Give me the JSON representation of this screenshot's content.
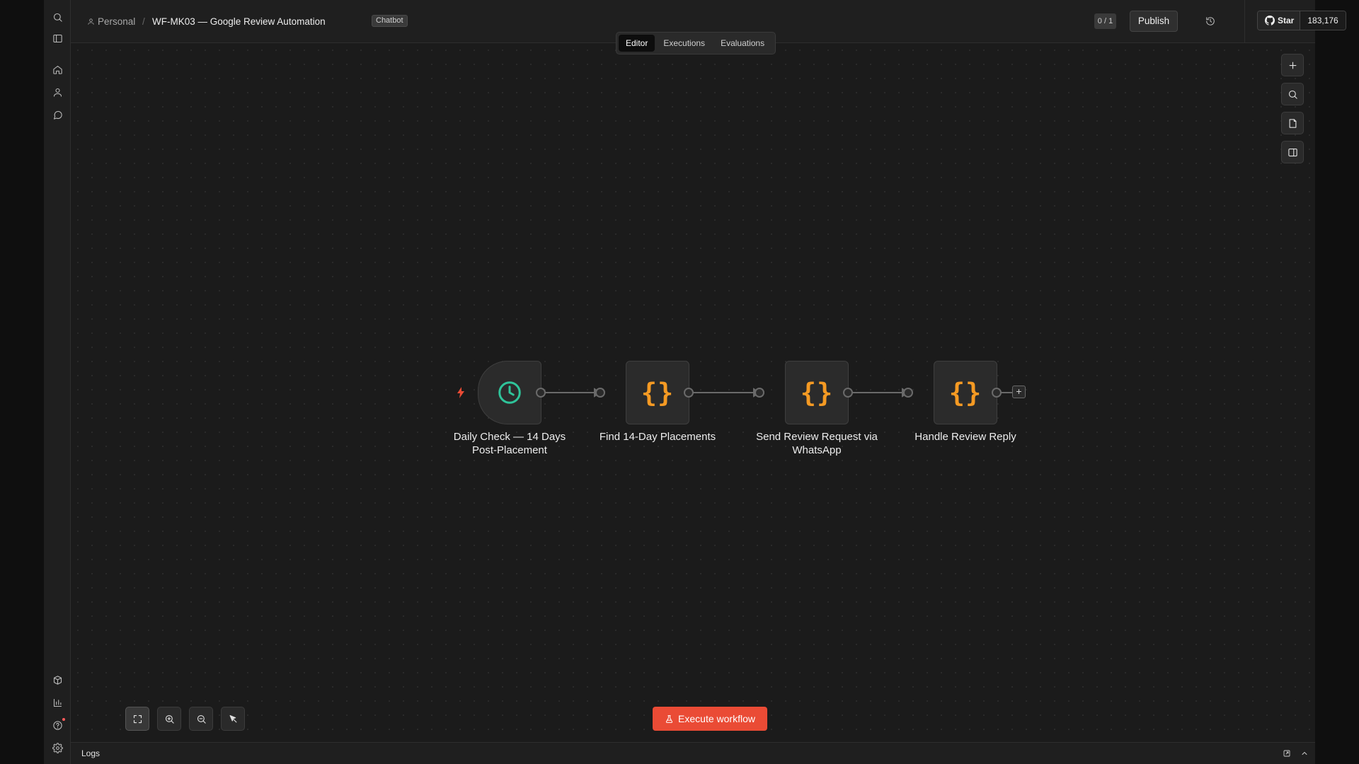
{
  "breadcrumb": {
    "user_icon": "user-icon",
    "owner": "Personal",
    "separator": "/",
    "workflow_name": "WF-MK03 — Google Review Automation",
    "tag": "Chatbot"
  },
  "tabs": [
    {
      "label": "Editor",
      "active": true
    },
    {
      "label": "Executions",
      "active": false
    },
    {
      "label": "Evaluations",
      "active": false
    }
  ],
  "header": {
    "counter": "0 / 1",
    "publish_label": "Publish",
    "history_icon": "history-icon",
    "github_star_label": "Star",
    "github_star_count": "183,176"
  },
  "sidebar": {
    "top_icons": [
      "search-icon",
      "sidebar-toggle-icon",
      "home-icon",
      "user-icon",
      "chat-icon"
    ],
    "bottom_icons": [
      "templates-icon",
      "insights-icon",
      "help-icon",
      "settings-icon"
    ]
  },
  "canvas_tools": [
    "add-node-icon",
    "search-icon",
    "sticky-note-icon",
    "panel-toggle-icon"
  ],
  "workflow": {
    "nodes": [
      {
        "id": "n1",
        "kind": "schedule-trigger",
        "icon": "clock-icon",
        "label_line1": "Daily Check — 14 Days",
        "label_line2": "Post-Placement"
      },
      {
        "id": "n2",
        "kind": "code",
        "icon": "braces-icon",
        "symbol": "{}",
        "label_line1": "Find 14-Day Placements",
        "label_line2": ""
      },
      {
        "id": "n3",
        "kind": "code",
        "icon": "braces-icon",
        "symbol": "{}",
        "label_line1": "Send Review Request via",
        "label_line2": "WhatsApp"
      },
      {
        "id": "n4",
        "kind": "code",
        "icon": "braces-icon",
        "symbol": "{}",
        "label_line1": "Handle Review Reply",
        "label_line2": ""
      }
    ],
    "connections": [
      [
        "n1",
        "n2"
      ],
      [
        "n2",
        "n3"
      ],
      [
        "n3",
        "n4"
      ]
    ],
    "trigger_marker_icon": "lightning-icon",
    "add_node_symbol": "+"
  },
  "zoom_controls": [
    "fit-view-icon",
    "zoom-in-icon",
    "zoom-out-icon",
    "tidy-up-icon"
  ],
  "execute_button": {
    "label": "Execute workflow",
    "icon": "flask-icon"
  },
  "logs": {
    "label": "Logs",
    "icons": [
      "popout-icon",
      "chevron-up-icon"
    ]
  },
  "colors": {
    "accent": "#ea4b35",
    "trigger_icon": "#2fc49a",
    "code_icon": "#f59a23",
    "background": "#1b1b1b"
  }
}
